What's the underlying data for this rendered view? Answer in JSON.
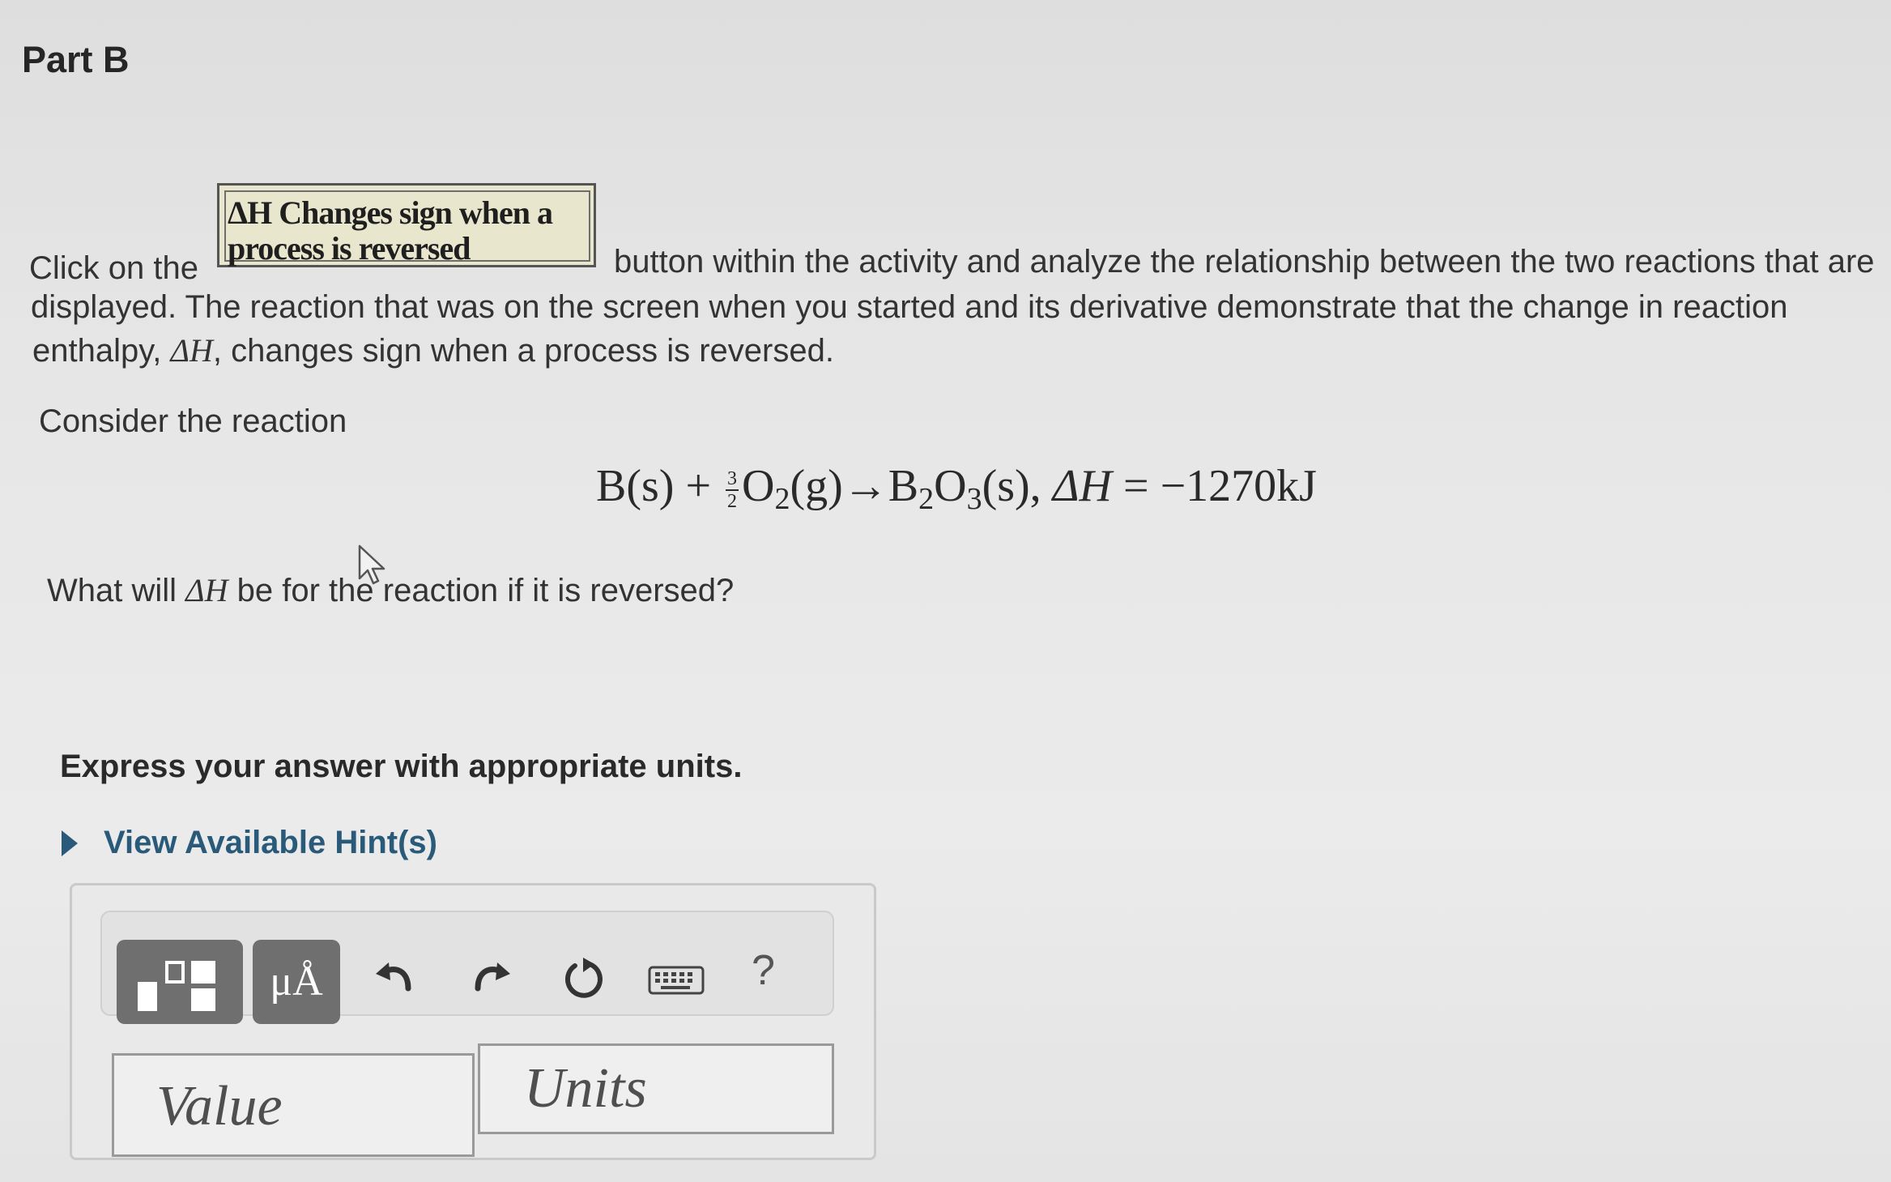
{
  "part_title": "Part B",
  "instructions": {
    "before_button": "Click on the",
    "button_label_line1": "ΔH Changes sign when a",
    "button_label_line2": "process is reversed",
    "after_button": "button within the activity and analyze the relationship between the two reactions that are",
    "line2": "displayed. The reaction that was on the screen when you started and its derivative demonstrate that the change in reaction",
    "line3_prefix": "enthalpy,",
    "line3_symbol": "ΔH",
    "line3_suffix": ", changes sign when a process is reversed."
  },
  "consider_text": "Consider the reaction",
  "equation": {
    "left": "B(s) +",
    "frac_num": "3",
    "frac_den": "2",
    "o2": "O",
    "o2_sub": "2",
    "o2_state": "(g)",
    "arrow": "→",
    "product_b": "B",
    "product_b_sub": "2",
    "product_o": "O",
    "product_o_sub": "3",
    "product_state": "(s),",
    "dh_label": "ΔH",
    "dh_value": "= −1270kJ"
  },
  "question": {
    "prefix": "What will",
    "symbol": "ΔH",
    "suffix": "be for the reaction if it is reversed?"
  },
  "express_text": "Express your answer with appropriate units.",
  "hint_label": "View Available Hint(s)",
  "toolbar": {
    "units_button_label": "μÅ",
    "help_label": "?"
  },
  "inputs": {
    "value_placeholder": "Value",
    "units_placeholder": "Units"
  }
}
